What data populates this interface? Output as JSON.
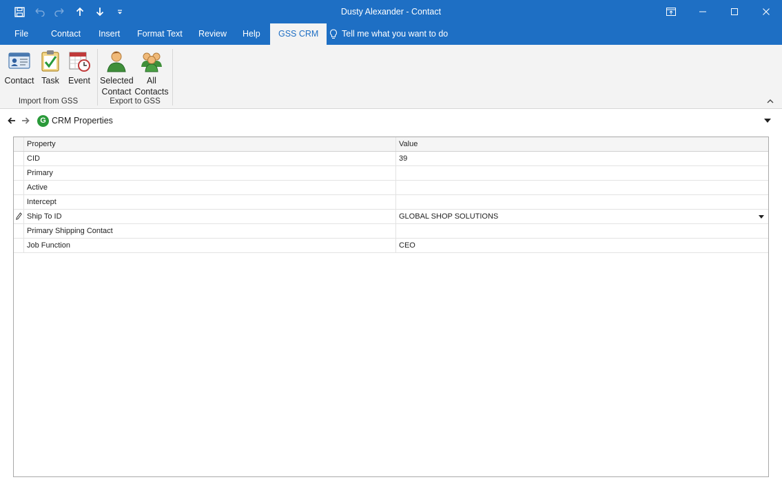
{
  "window": {
    "title": "Dusty Alexander  -  Contact"
  },
  "qat": {
    "save_icon": "save-icon",
    "undo_icon": "undo-icon",
    "redo_icon": "redo-icon",
    "up_icon": "arrow-up-icon",
    "down_icon": "arrow-down-icon",
    "customize_icon": "customize-qat-icon"
  },
  "tabs": [
    {
      "label": "File"
    },
    {
      "label": "Contact"
    },
    {
      "label": "Insert"
    },
    {
      "label": "Format Text"
    },
    {
      "label": "Review"
    },
    {
      "label": "Help"
    },
    {
      "label": "GSS CRM"
    }
  ],
  "tell_me": "Tell me what you want to do",
  "ribbon": {
    "import_group": {
      "label": "Import from GSS",
      "buttons": [
        {
          "label": "Contact",
          "icon": "contact-card-icon"
        },
        {
          "label": "Task",
          "icon": "task-clipboard-icon"
        },
        {
          "label": "Event",
          "icon": "calendar-event-icon"
        }
      ]
    },
    "export_group": {
      "label": "Export to GSS",
      "buttons": [
        {
          "line1": "Selected",
          "line2": "Contact",
          "icon": "person-icon"
        },
        {
          "line1": "All",
          "line2": "Contacts",
          "icon": "people-icon"
        }
      ]
    }
  },
  "navbar": {
    "title": "CRM Properties",
    "logo_letter": "G"
  },
  "grid": {
    "headers": {
      "property": "Property",
      "value": "Value"
    },
    "rows": [
      {
        "property": "CID",
        "value": "39",
        "type": "text"
      },
      {
        "property": "Primary",
        "value": "",
        "type": "checkbox",
        "checked": true
      },
      {
        "property": "Active",
        "value": "",
        "type": "checkbox",
        "checked": true
      },
      {
        "property": "Intercept",
        "value": "",
        "type": "checkbox",
        "checked": false
      },
      {
        "property": "Ship To ID",
        "value": "GLOBAL SHOP SOLUTIONS",
        "type": "dropdown",
        "editing": true
      },
      {
        "property": "Primary Shipping Contact",
        "value": "",
        "type": "checkbox",
        "checked": true
      },
      {
        "property": "Job Function",
        "value": "CEO",
        "type": "text"
      }
    ]
  },
  "colors": {
    "title_bar": "#1e6fc4",
    "ribbon_bg": "#f3f3f3",
    "crm_logo": "#2a9a3a"
  }
}
